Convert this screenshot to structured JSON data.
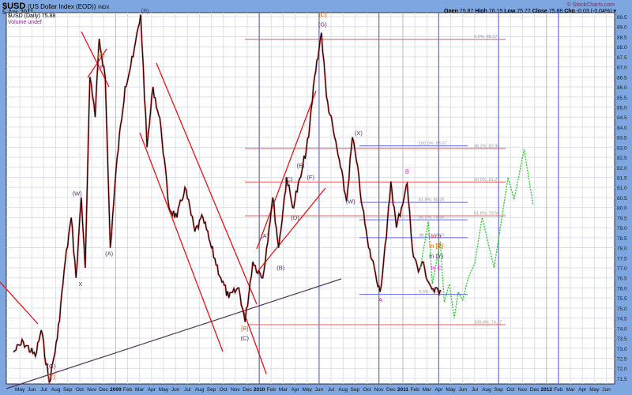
{
  "header": {
    "symbol": "$USD",
    "name": "(US Dollar Index (EOD))",
    "exchange": "INDX",
    "date": "5-Apr-2011",
    "brand": "© StockCharts.com",
    "open_label": "Open",
    "open": "75.87",
    "high_label": "High",
    "high": "76.15",
    "low_label": "Low",
    "low": "75.77",
    "close_label": "Close",
    "close": "75.88",
    "chg_label": "Chg",
    "chg": "-0.03 (-0.04%)"
  },
  "legend": {
    "series": "$USD (Daily) 75.88",
    "volume": "Volume undef"
  },
  "chart_data": {
    "type": "line",
    "title": "",
    "ylim": [
      71.5,
      89.5
    ],
    "ytick_step": 0.5,
    "grid": true,
    "xtick_labels": [
      "May",
      "Jun",
      "Jul",
      "Aug",
      "Sep",
      "Oct",
      "Nov",
      "Dec",
      "2009",
      "Feb",
      "Mar",
      "Apr",
      "May",
      "Jun",
      "Jul",
      "Aug",
      "Sep",
      "Oct",
      "Nov",
      "Dec",
      "2010",
      "Feb",
      "Mar",
      "Apr",
      "May",
      "Jun",
      "Jul",
      "Aug",
      "Sep",
      "Oct",
      "Nov",
      "Dec",
      "2011",
      "Feb",
      "Mar",
      "Apr",
      "May",
      "Jun",
      "Jul",
      "Aug",
      "Sep",
      "Oct",
      "Nov",
      "Dec",
      "2012",
      "Feb",
      "Mar",
      "Apr",
      "May",
      "Jun"
    ],
    "price_series": [
      [
        "2008-04-15",
        72.8
      ],
      [
        "2008-05-10",
        73.3
      ],
      [
        "2008-06-10",
        72.6
      ],
      [
        "2008-06-25",
        73.9
      ],
      [
        "2008-07-15",
        71.3
      ],
      [
        "2008-08-05",
        73.5
      ],
      [
        "2008-08-25",
        77.3
      ],
      [
        "2008-09-10",
        79.5
      ],
      [
        "2008-09-22",
        76.5
      ],
      [
        "2008-10-05",
        80.5
      ],
      [
        "2008-10-15",
        77.0
      ],
      [
        "2008-10-27",
        86.5
      ],
      [
        "2008-11-10",
        84.5
      ],
      [
        "2008-11-20",
        88.4
      ],
      [
        "2008-12-05",
        86.5
      ],
      [
        "2008-12-18",
        78.0
      ],
      [
        "2009-01-05",
        82.5
      ],
      [
        "2009-01-25",
        86.0
      ],
      [
        "2009-02-15",
        87.5
      ],
      [
        "2009-03-04",
        89.6
      ],
      [
        "2009-03-20",
        83.0
      ],
      [
        "2009-04-05",
        86.0
      ],
      [
        "2009-04-25",
        84.0
      ],
      [
        "2009-05-15",
        80.0
      ],
      [
        "2009-06-05",
        79.5
      ],
      [
        "2009-06-25",
        81.0
      ],
      [
        "2009-07-20",
        78.8
      ],
      [
        "2009-08-10",
        79.5
      ],
      [
        "2009-09-01",
        78.0
      ],
      [
        "2009-09-25",
        76.5
      ],
      [
        "2009-10-15",
        75.5
      ],
      [
        "2009-11-10",
        76.0
      ],
      [
        "2009-11-26",
        74.3
      ],
      [
        "2009-12-15",
        77.3
      ],
      [
        "2010-01-10",
        76.5
      ],
      [
        "2010-02-05",
        80.5
      ],
      [
        "2010-02-20",
        78.0
      ],
      [
        "2010-03-10",
        81.5
      ],
      [
        "2010-03-25",
        80.0
      ],
      [
        "2010-04-15",
        81.5
      ],
      [
        "2010-05-05",
        83.5
      ],
      [
        "2010-05-20",
        86.5
      ],
      [
        "2010-06-07",
        88.7
      ],
      [
        "2010-06-20",
        85.5
      ],
      [
        "2010-07-10",
        83.5
      ],
      [
        "2010-07-25",
        82.0
      ],
      [
        "2010-08-10",
        80.3
      ],
      [
        "2010-08-25",
        83.5
      ],
      [
        "2010-09-05",
        82.3
      ],
      [
        "2010-09-20",
        80.0
      ],
      [
        "2010-10-05",
        78.0
      ],
      [
        "2010-10-20",
        77.0
      ],
      [
        "2010-11-04",
        75.8
      ],
      [
        "2010-11-20",
        78.5
      ],
      [
        "2010-12-01",
        81.3
      ],
      [
        "2010-12-15",
        79.0
      ],
      [
        "2011-01-07",
        80.8
      ],
      [
        "2011-01-12",
        81.2
      ],
      [
        "2011-01-25",
        78.0
      ],
      [
        "2011-02-10",
        76.8
      ],
      [
        "2011-02-20",
        77.3
      ],
      [
        "2011-03-05",
        76.3
      ],
      [
        "2011-03-20",
        75.8
      ],
      [
        "2011-04-05",
        75.9
      ]
    ],
    "projection_series": [
      [
        "2011-02-15",
        77.0
      ],
      [
        "2011-03-05",
        79.3
      ],
      [
        "2011-03-15",
        76.2
      ],
      [
        "2011-04-05",
        78.3
      ],
      [
        "2011-04-15",
        75.3
      ],
      [
        "2011-04-28",
        76.2
      ],
      [
        "2011-05-10",
        74.5
      ],
      [
        "2011-05-20",
        75.8
      ],
      [
        "2011-06-01",
        75.4
      ],
      [
        "2011-06-15",
        76.5
      ],
      [
        "2011-07-01",
        77.2
      ],
      [
        "2011-07-20",
        79.5
      ],
      [
        "2011-08-20",
        77.0
      ],
      [
        "2011-09-25",
        81.5
      ],
      [
        "2011-10-10",
        80.4
      ],
      [
        "2011-11-05",
        82.9
      ],
      [
        "2011-11-28",
        80.1
      ]
    ],
    "fib_levels_blue": [
      "100.0%: 83.07",
      "61.8%: 80.26",
      "50.0%: 79.39",
      "38.2%: 78.50",
      "0.0%: 75.68"
    ],
    "fib_levels_red": [
      "0.0%: 88.37",
      "38.2%: 82.94",
      "50.0%: 81.27",
      "61.8%: 79.59",
      "100.0%: 74.17"
    ],
    "fib_values_blue": [
      83.07,
      80.26,
      79.39,
      78.5,
      75.68
    ],
    "fib_values_red": [
      88.37,
      82.94,
      81.27,
      79.59,
      74.17
    ],
    "wave_labels": [
      {
        "text": "(B)",
        "date": "2009-03-15",
        "price": 89.7,
        "color": "#553366"
      },
      {
        "text": "[A]",
        "date": "2008-11-25",
        "price": 87.5,
        "color": "#e06010"
      },
      {
        "text": "(Y)",
        "date": "2008-11-25",
        "price": 86.9,
        "color": "#553366"
      },
      {
        "text": "(W)",
        "date": "2008-09-25",
        "price": 80.6,
        "color": "#553366"
      },
      {
        "text": "X",
        "date": "2008-10-03",
        "price": 76.1,
        "color": "#553366"
      },
      {
        "text": "(A)",
        "date": "2008-12-15",
        "price": 77.6,
        "color": "#553366"
      },
      {
        "text": "(G)",
        "date": "2008-07-20",
        "price": 72.0,
        "color": "#553366"
      },
      {
        "text": "[Y]",
        "date": "2008-07-20",
        "price": 71.5,
        "color": "#e06010"
      },
      {
        "text": "[C]",
        "date": "2010-06-10",
        "price": 89.5,
        "color": "#e06010"
      },
      {
        "text": "(G)",
        "date": "2010-06-10",
        "price": 89.0,
        "color": "#553366"
      },
      {
        "text": "(E)",
        "date": "2010-04-15",
        "price": 82.0,
        "color": "#553366"
      },
      {
        "text": "(C)",
        "date": "2010-03-15",
        "price": 81.3,
        "color": "#553366"
      },
      {
        "text": "(F)",
        "date": "2010-05-10",
        "price": 81.4,
        "color": "#553366"
      },
      {
        "text": "(D)",
        "date": "2010-04-01",
        "price": 79.4,
        "color": "#553366"
      },
      {
        "text": "(A)",
        "date": "2010-01-15",
        "price": 78.5,
        "color": "#553366"
      },
      {
        "text": "(B)",
        "date": "2010-02-25",
        "price": 76.9,
        "color": "#553366"
      },
      {
        "text": "[B]",
        "date": "2009-11-25",
        "price": 73.9,
        "color": "#e06010"
      },
      {
        "text": "(C)",
        "date": "2009-11-25",
        "price": 73.4,
        "color": "#553366"
      },
      {
        "text": "(X)",
        "date": "2010-09-10",
        "price": 83.6,
        "color": "#553366"
      },
      {
        "text": "(W)",
        "date": "2010-08-20",
        "price": 80.2,
        "color": "#553366"
      },
      {
        "text": "B",
        "date": "2011-01-12",
        "price": 81.7,
        "color": "#e020e0"
      },
      {
        "text": "A",
        "date": "2010-11-05",
        "price": 75.3,
        "color": "#e020e0"
      },
      {
        "text": "In b",
        "date": "2011-03-25",
        "price": 78.5,
        "color": "#e02020"
      },
      {
        "text": "In [D]",
        "date": "2011-03-25",
        "price": 78.0,
        "color": "#e06010"
      },
      {
        "text": "In (Y)",
        "date": "2011-03-25",
        "price": 77.5,
        "color": "#553366"
      },
      {
        "text": "In C",
        "date": "2011-03-25",
        "price": 76.9,
        "color": "#e020e0"
      }
    ]
  },
  "colors": {
    "frame": "#7ea6e0",
    "price": "#000000",
    "price_overlay": "#e02020",
    "projection": "#22cc22",
    "trend_red": "#ee1111",
    "trend_dark": "#553355",
    "vline": "#6666ee",
    "fib_blue": "#6666ee",
    "fib_red": "#ee5555"
  }
}
